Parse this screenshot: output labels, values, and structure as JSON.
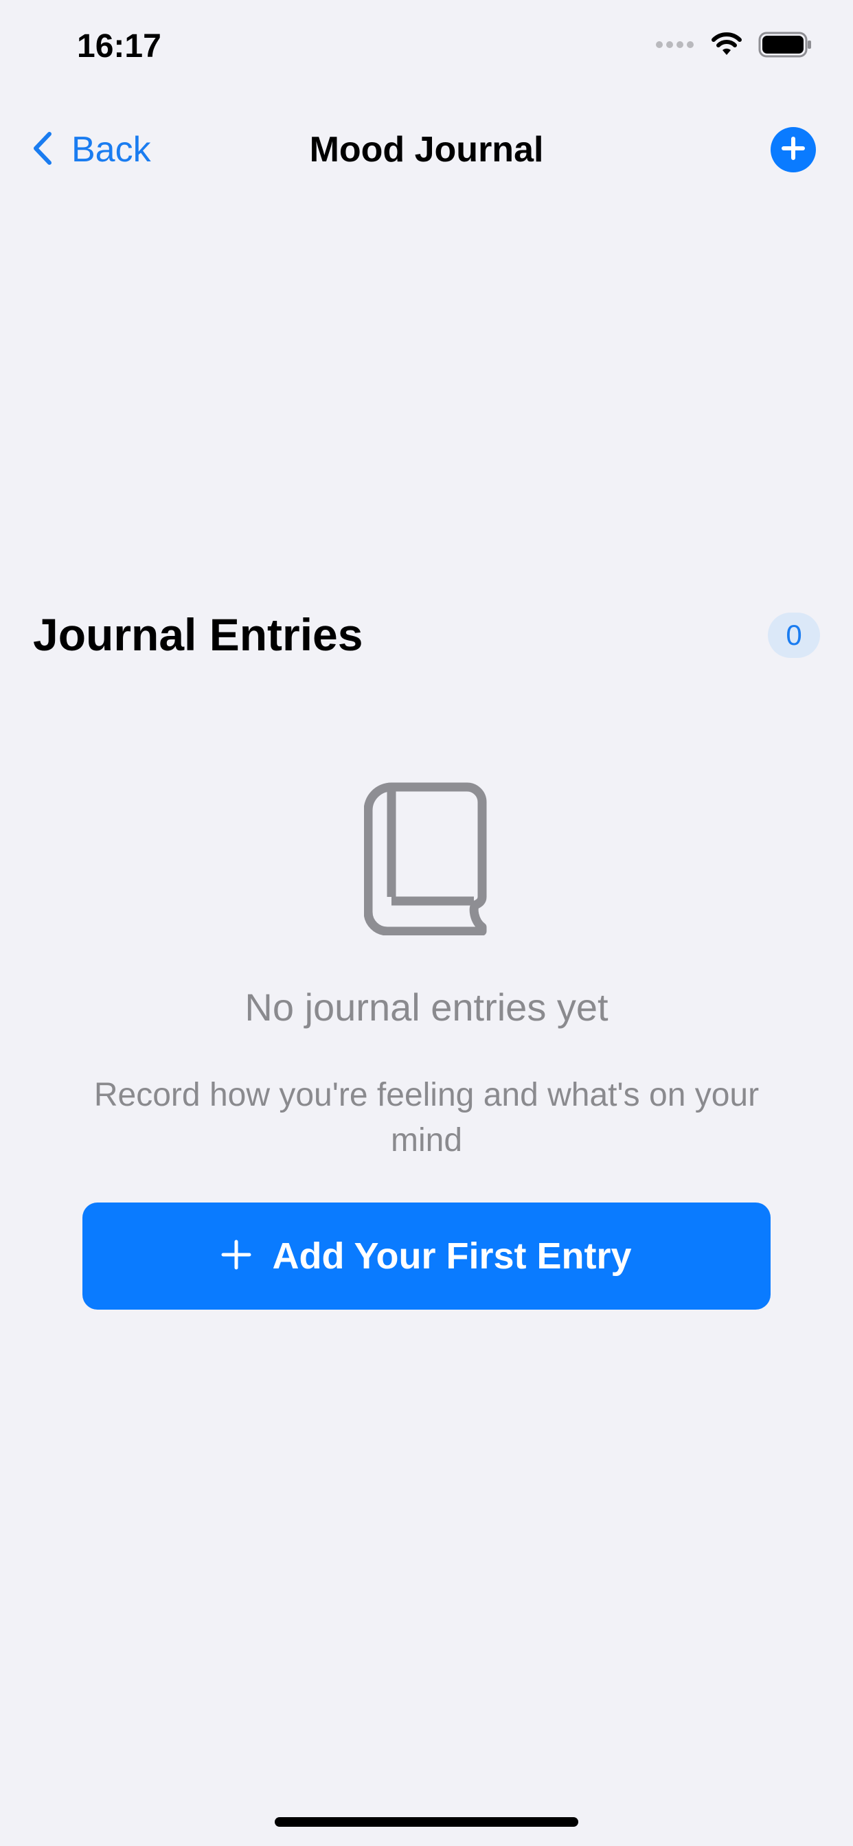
{
  "status_bar": {
    "time": "16:17",
    "icons": [
      "signal-dots-icon",
      "wifi-icon",
      "battery-icon"
    ]
  },
  "nav": {
    "back_label": "Back",
    "title": "Mood Journal",
    "add_icon": "plus-circle-icon"
  },
  "section": {
    "title": "Journal Entries",
    "count": "0"
  },
  "empty_state": {
    "icon": "book-icon",
    "title": "No journal entries yet",
    "subtitle": "Record how you're feeling and what's on your mind"
  },
  "primary_button": {
    "icon": "plus-icon",
    "label": "Add Your First Entry"
  },
  "colors": {
    "background": "#f2f2f7",
    "accent": "#0a7bff",
    "secondary_text": "#8a8a8e",
    "badge_background": "#dbe8f8"
  }
}
